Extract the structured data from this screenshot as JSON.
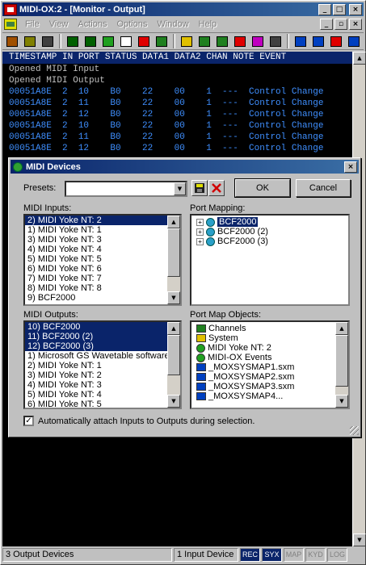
{
  "app": {
    "title": "MIDI-OX:2 - [Monitor - Output]",
    "menu": [
      "File",
      "View",
      "Actions",
      "Options",
      "Window",
      "Help"
    ]
  },
  "toolbar": {
    "icons": [
      "open-icon",
      "save-icon",
      "print-icon",
      "midi-input-icon",
      "midi-output-icon",
      "green-circle-icon",
      "grid-icon",
      "sysex-icon",
      "filter-icon",
      "pencil-icon",
      "keyboard-icon",
      "instruments-icon",
      "mp-icon",
      "mapper-icon",
      "piano-icon",
      "port-routing-icon",
      "hub-icon",
      "panic-icon",
      "config-icon"
    ],
    "colors": [
      "#a05000",
      "#808000",
      "#404040",
      "#006000",
      "#006000",
      "#20a020",
      "#ffffff",
      "#e00000",
      "#208020",
      "#e0c000",
      "#208020",
      "#208020",
      "#e00000",
      "#c000c0",
      "#404040",
      "#0040c0",
      "#0040c0",
      "#e00000",
      "#0040c0"
    ]
  },
  "monitor": {
    "header": "TIMESTAMP IN PORT STATUS DATA1 DATA2 CHAN NOTE EVENT",
    "messages": [
      "Opened MIDI Input",
      "Opened MIDI Output"
    ],
    "rows": [
      "00051A8E  2  10    B0    22    00    1  ---  Control Change",
      "00051A8E  2  11    B0    22    00    1  ---  Control Change",
      "00051A8E  2  12    B0    22    00    1  ---  Control Change",
      "00051A8E  2  10    B0    22    00    1  ---  Control Change",
      "00051A8E  2  11    B0    22    00    1  ---  Control Change",
      "00051A8E  2  12    B0    22    00    1  ---  Control Change"
    ],
    "text_color": "#3f8fff"
  },
  "dialog": {
    "title": "MIDI Devices",
    "presets_label": "Presets:",
    "presets_value": "",
    "ok": "OK",
    "cancel": "Cancel",
    "midi_inputs_label": "MIDI Inputs:",
    "midi_inputs": [
      {
        "label": "2) MIDI Yoke NT:  2",
        "selected": true
      },
      {
        "label": "1) MIDI Yoke NT:  1",
        "selected": false
      },
      {
        "label": "3) MIDI Yoke NT:  3",
        "selected": false
      },
      {
        "label": "4) MIDI Yoke NT:  4",
        "selected": false
      },
      {
        "label": "5) MIDI Yoke NT:  5",
        "selected": false
      },
      {
        "label": "6) MIDI Yoke NT:  6",
        "selected": false
      },
      {
        "label": "7) MIDI Yoke NT:  7",
        "selected": false
      },
      {
        "label": "8) MIDI Yoke NT:  8",
        "selected": false
      },
      {
        "label": "9) BCF2000",
        "selected": false
      }
    ],
    "port_mapping_label": "Port Mapping:",
    "port_mapping": [
      {
        "label": "BCF2000",
        "expander": "+",
        "selected": true
      },
      {
        "label": "BCF2000 (2)",
        "expander": "+",
        "selected": false
      },
      {
        "label": "BCF2000 (3)",
        "expander": "+",
        "selected": false
      }
    ],
    "midi_outputs_label": "MIDI Outputs:",
    "midi_outputs": [
      {
        "label": "10) BCF2000",
        "selected": true
      },
      {
        "label": "11) BCF2000 (2)",
        "selected": true
      },
      {
        "label": "12) BCF2000 (3)",
        "selected": true
      },
      {
        "label": "1) Microsoft GS Wavetable software",
        "selected": false
      },
      {
        "label": "2) MIDI Yoke NT:  1",
        "selected": false
      },
      {
        "label": "3) MIDI Yoke NT:  2",
        "selected": false
      },
      {
        "label": "4) MIDI Yoke NT:  3",
        "selected": false
      },
      {
        "label": "5) MIDI Yoke NT:  4",
        "selected": false
      },
      {
        "label": "6) MIDI Yoke NT:  5",
        "selected": false
      }
    ],
    "port_map_objects_label": "Port Map Objects:",
    "port_map_objects": [
      {
        "label": "Channels",
        "icon": "channels-icon",
        "color": "#208020"
      },
      {
        "label": "System",
        "icon": "system-icon",
        "color": "#e0c000"
      },
      {
        "label": "MIDI Yoke NT:  2",
        "icon": "yoke-icon",
        "color": "#20a020"
      },
      {
        "label": "MIDI-OX Events",
        "icon": "midiox-icon",
        "color": "#20a020"
      },
      {
        "label": "_MOXSYSMAP1.sxm",
        "icon": "sysex-map-icon",
        "color": "#0040c0"
      },
      {
        "label": "_MOXSYSMAP2.sxm",
        "icon": "sysex-map-icon",
        "color": "#0040c0"
      },
      {
        "label": "_MOXSYSMAP3.sxm",
        "icon": "sysex-map-icon",
        "color": "#0040c0"
      },
      {
        "label": "_MOXSYSMAP4...",
        "icon": "sysex-map-icon",
        "color": "#0040c0"
      }
    ],
    "auto_attach_label": "Automatically attach Inputs to Outputs during selection.",
    "auto_attach_checked": true,
    "check_mark": "✓"
  },
  "status": {
    "output_devices": "3 Output Devices",
    "input_devices": "1 Input Device",
    "indicators": [
      {
        "label": "REC",
        "on": true
      },
      {
        "label": "SYX",
        "on": true
      },
      {
        "label": "MAP",
        "on": false
      },
      {
        "label": "KYD",
        "on": false
      },
      {
        "label": "LOG",
        "on": false
      }
    ]
  }
}
